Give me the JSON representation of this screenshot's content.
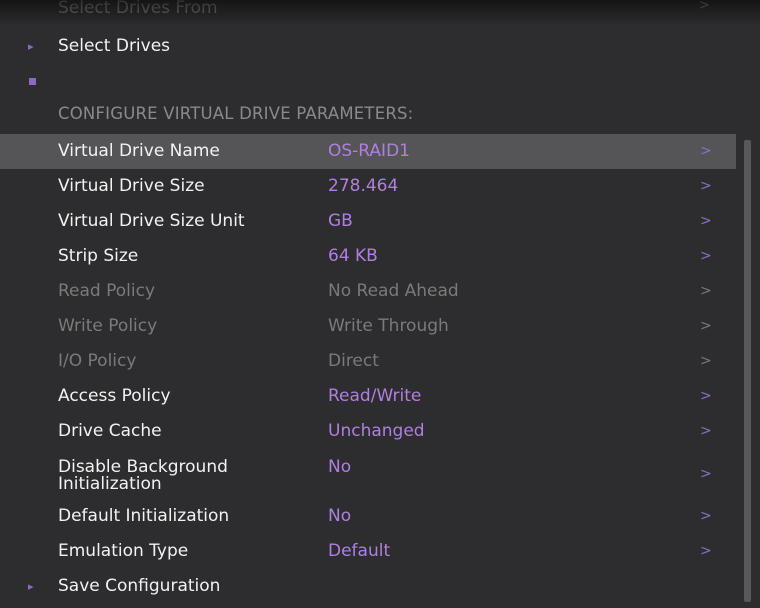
{
  "nav": {
    "cutoff_label": "Select Drives From",
    "select_drives_label": "Select Drives",
    "save_configuration_label": "Save Configuration",
    "arrow": ">",
    "bullet": "▸"
  },
  "section_header": "CONFIGURE VIRTUAL DRIVE PARAMETERS:",
  "params": [
    {
      "label": "Virtual Drive Name",
      "value": "OS-RAID1",
      "arrow": ">"
    },
    {
      "label": "Virtual Drive Size",
      "value": "278.464",
      "arrow": ">"
    },
    {
      "label": "Virtual Drive Size Unit",
      "value": "GB",
      "arrow": ">"
    },
    {
      "label": "Strip Size",
      "value": "64 KB",
      "arrow": ">"
    },
    {
      "label": "Read Policy",
      "value": "No Read Ahead",
      "arrow": ">"
    },
    {
      "label": "Write Policy",
      "value": "Write Through",
      "arrow": ">"
    },
    {
      "label": "I/O Policy",
      "value": "Direct",
      "arrow": ">"
    },
    {
      "label": "Access Policy",
      "value": "Read/Write",
      "arrow": ">"
    },
    {
      "label": "Drive Cache",
      "value": "Unchanged",
      "arrow": ">"
    },
    {
      "label": "Disable Background\nInitialization",
      "value": "No",
      "arrow": ">"
    },
    {
      "label": "Default Initialization",
      "value": "No",
      "arrow": ">"
    },
    {
      "label": "Emulation Type",
      "value": "Default",
      "arrow": ">"
    }
  ],
  "colors": {
    "background": "#2d2d2f",
    "selected_row": "#555558",
    "accent_value": "#b07fe0",
    "label_text": "#f2f2f2",
    "disabled_text": "#7a7a7a"
  }
}
